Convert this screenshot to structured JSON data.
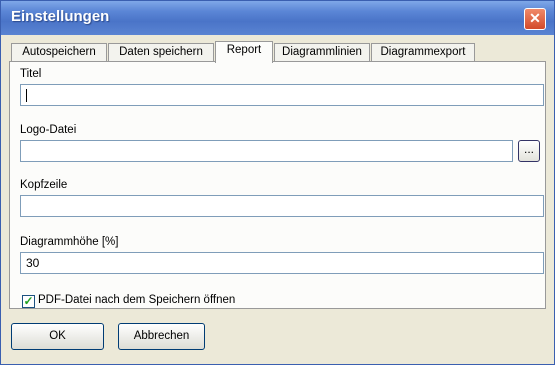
{
  "window": {
    "title": "Einstellungen",
    "close_glyph": "✕"
  },
  "tabs": [
    {
      "label": "Autospeichern"
    },
    {
      "label": "Daten speichern"
    },
    {
      "label": "Report",
      "active": true
    },
    {
      "label": "Diagrammlinien"
    },
    {
      "label": "Diagrammexport"
    }
  ],
  "form": {
    "titel": {
      "label": "Titel",
      "value": ""
    },
    "logo": {
      "label": "Logo-Datei",
      "value": "",
      "browse_label": "..."
    },
    "kopfzeile": {
      "label": "Kopfzeile",
      "value": ""
    },
    "diagrammhoehe": {
      "label": "Diagrammhöhe [%]",
      "value": "30"
    },
    "pdf_open": {
      "label": "PDF-Datei nach dem Speichern öffnen",
      "checked": true
    }
  },
  "buttons": {
    "ok": "OK",
    "cancel": "Abbrechen"
  },
  "icons": {
    "close": "close-icon",
    "check": "checkmark-icon"
  },
  "colors": {
    "titlebar": "#5b86d6",
    "close": "#d34a2a",
    "check": "#21a121"
  }
}
